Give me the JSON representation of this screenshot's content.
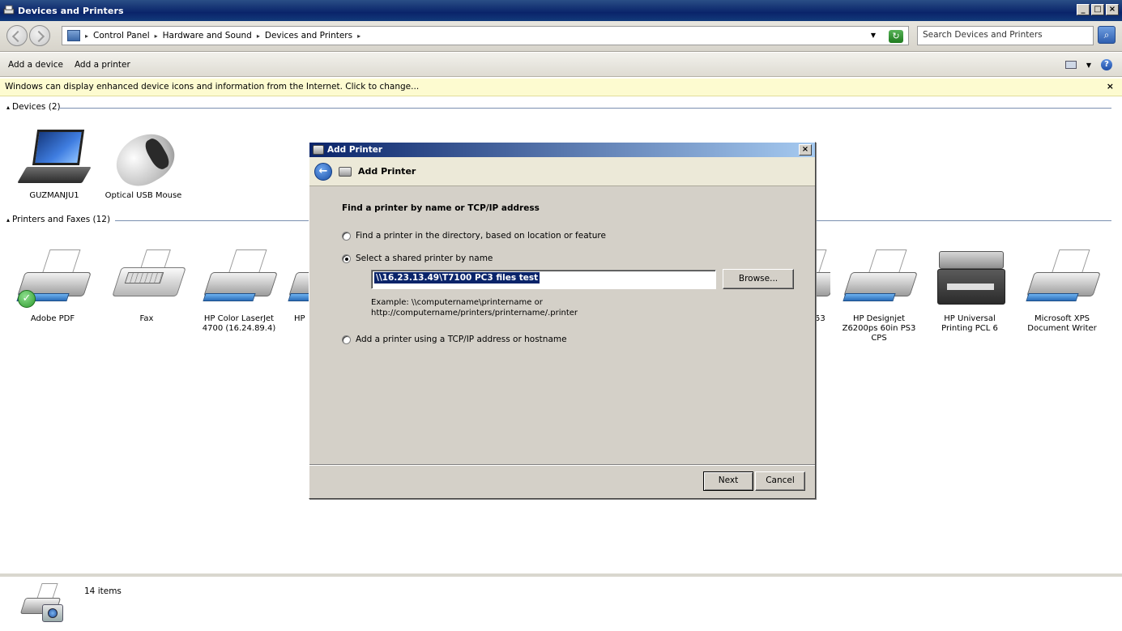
{
  "window": {
    "title": "Devices and Printers",
    "min_label": "_",
    "max_label": "□",
    "close_label": "×"
  },
  "address": {
    "breadcrumbs": [
      "Control Panel",
      "Hardware and Sound",
      "Devices and Printers"
    ],
    "search_placeholder": "Search Devices and Printers"
  },
  "toolbar": {
    "add_device": "Add a device",
    "add_printer": "Add a printer"
  },
  "infobar": {
    "message": "Windows can display enhanced device icons and information from the Internet. Click to change...",
    "close": "×"
  },
  "groups": {
    "devices": "Devices (2)",
    "printers": "Printers and Faxes (12)"
  },
  "devices": [
    {
      "label": "GUZMANJU1"
    },
    {
      "label": "Optical USB Mouse"
    }
  ],
  "printers": [
    {
      "label": "Adobe PDF"
    },
    {
      "label": "Fax"
    },
    {
      "label": "HP Color LaserJet 4700 (16.24.89.4)"
    },
    {
      "label": "HP"
    },
    {
      "label": "53"
    },
    {
      "label": "HP Designjet Z6200ps 60in PS3 CPS"
    },
    {
      "label": "HP Universal Printing PCL 6"
    },
    {
      "label": "Microsoft XPS Document Writer"
    }
  ],
  "status": {
    "count": "14 items"
  },
  "dialog": {
    "window_title": "Add Printer",
    "header_title": "Add Printer",
    "heading": "Find a printer by name or TCP/IP address",
    "options": [
      {
        "label": "Find a printer in the directory, based on location or feature",
        "checked": false
      },
      {
        "label": "Select a shared printer by name",
        "checked": true
      },
      {
        "label": "Add a printer using a TCP/IP address or hostname",
        "checked": false
      }
    ],
    "printer_name_value": "\\\\16.23.13.49\\T7100 PC3 files test",
    "browse_label": "Browse...",
    "example_line1": "Example: \\\\computername\\printername or",
    "example_line2": "http://computername/printers/printername/.printer",
    "next_label": "Next",
    "cancel_label": "Cancel"
  }
}
